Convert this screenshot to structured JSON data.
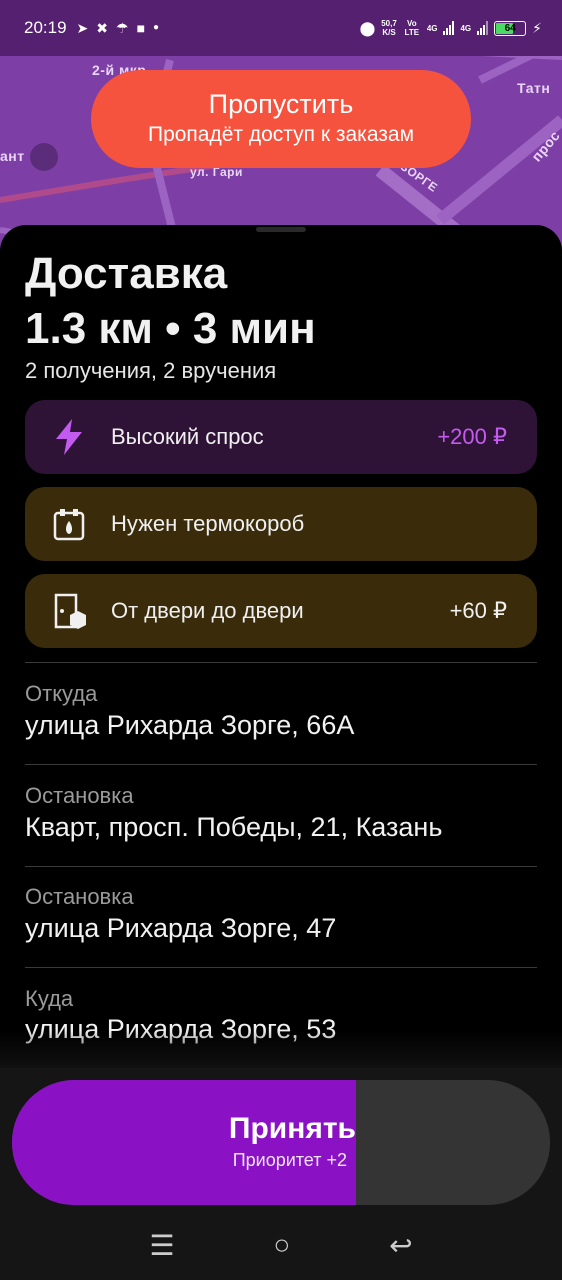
{
  "status_bar": {
    "time": "20:19",
    "net_speed_value": "50,7",
    "net_speed_unit": "K/S",
    "volte": "Vo LTE",
    "net1": "4G",
    "net2": "4G",
    "battery_percent": "64",
    "battery_level": 0.64
  },
  "map": {
    "labels": [
      "2-й мкр",
      "Татн",
      "ант",
      "ул. Гари",
      "ЗОРГЕ",
      "прос"
    ]
  },
  "skip_button": {
    "title": "Пропустить",
    "subtitle": "Пропадёт доступ к заказам",
    "color": "#f5533d"
  },
  "order": {
    "type": "Доставка",
    "distance_time": "1.3 км • 3 мин",
    "counts": "2 получения, 2 вручения"
  },
  "cards": {
    "demand": {
      "label": "Высокий спрос",
      "value": "+200 ₽",
      "value_color": "#c45bf0",
      "icon": "lightning-icon"
    },
    "thermo": {
      "label": "Нужен термокороб",
      "icon": "thermobox-icon"
    },
    "door": {
      "label": "От двери до двери",
      "value": "+60 ₽",
      "icon": "door-to-door-icon"
    }
  },
  "route": [
    {
      "label": "Откуда",
      "address": "улица Рихарда Зорге, 66А"
    },
    {
      "label": "Остановка",
      "address": "Кварт, просп. Победы, 21, Казань"
    },
    {
      "label": "Остановка",
      "address": "улица Рихарда Зорге, 47"
    },
    {
      "label": "Куда",
      "address": "улица Рихарда Зорге, 53"
    }
  ],
  "accept_button": {
    "title": "Принять",
    "subtitle": "Приоритет +2",
    "progress": 0.64,
    "color": "#8a12c4"
  },
  "navbar": {
    "menu_icon": "☰",
    "home_icon": "○",
    "back_icon": "↩"
  }
}
